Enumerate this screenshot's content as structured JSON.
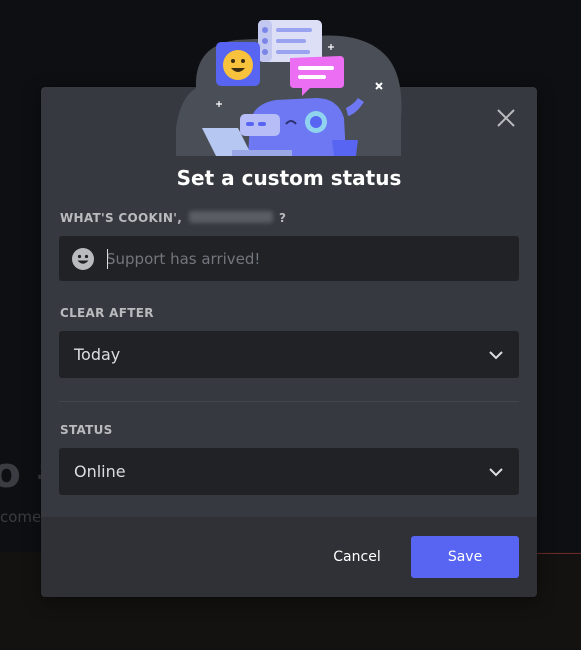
{
  "background": {
    "heading_fragment": "o #",
    "sub_fragment": "come"
  },
  "modal": {
    "title": "Set a custom status",
    "status_label_prefix": "WHAT'S COOKIN',",
    "status_label_suffix": "?",
    "status_input": {
      "value": "",
      "placeholder": "Support has arrived!"
    },
    "clear_after": {
      "label": "CLEAR AFTER",
      "selected": "Today"
    },
    "status": {
      "label": "STATUS",
      "selected": "Online"
    },
    "cancel_label": "Cancel",
    "save_label": "Save"
  },
  "icons": {
    "close": "close-icon",
    "emoji": "smiley-emoji-icon",
    "chevron": "chevron-down-icon"
  },
  "colors": {
    "modal_bg": "#36393f",
    "footer_bg": "#2f3136",
    "input_bg": "#202225",
    "accent": "#5865f2",
    "label": "#b9bbbe"
  }
}
